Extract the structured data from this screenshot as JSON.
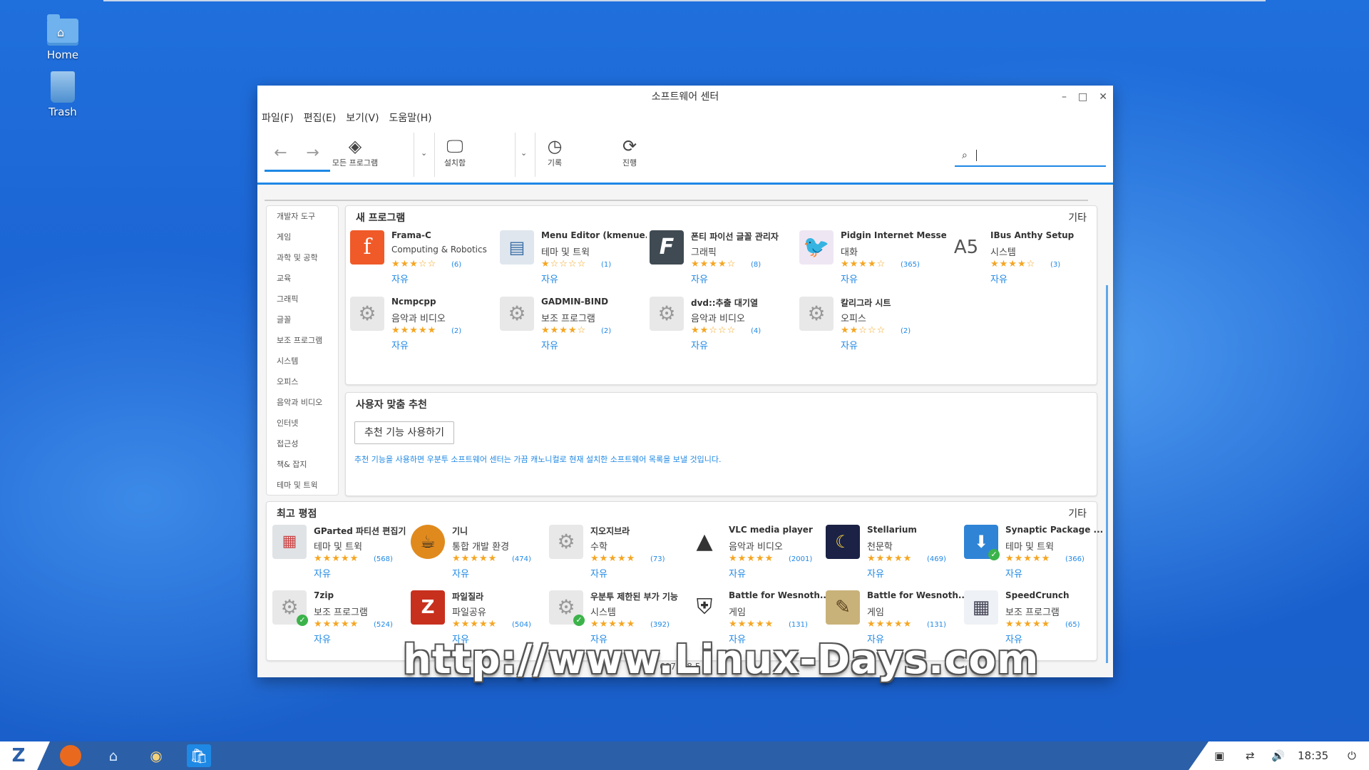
{
  "desktop": {
    "icons": [
      {
        "label": "Home"
      },
      {
        "label": "Trash"
      }
    ]
  },
  "window": {
    "title": "소프트웨어 센터",
    "menu": [
      "파일(F)",
      "편집(E)",
      "보기(V)",
      "도움말(H)"
    ],
    "toolbar": {
      "all_programs": "모든 프로그램",
      "installed": "설치함",
      "history": "기록",
      "progress": "진행"
    },
    "search": {
      "placeholder": ""
    }
  },
  "sidebar": {
    "items": [
      "개발자 도구",
      "게임",
      "과학 및 공학",
      "교육",
      "그래픽",
      "글꼴",
      "보조 프로그램",
      "시스템",
      "오피스",
      "음악과 비디오",
      "인터넷",
      "접근성",
      "책& 잡지",
      "테마 및 트윅"
    ]
  },
  "new_programs": {
    "title": "새 프로그램",
    "more": "기타",
    "apps": [
      {
        "name": "Frama-C",
        "category": "Computing & Robotics",
        "stars": "★★★☆☆",
        "count": "(6)",
        "license": "자유",
        "icon": "frama-c-icon"
      },
      {
        "name": "Menu Editor (kmenue...",
        "category": "테마 및 트윅",
        "stars": "★☆☆☆☆",
        "count": "(1)",
        "license": "자유",
        "icon": "menu-editor-icon"
      },
      {
        "name": "폰티 파이선 글꼴 관리자",
        "category": "그래픽",
        "stars": "★★★★☆",
        "count": "(8)",
        "license": "자유",
        "icon": "font-manager-icon"
      },
      {
        "name": "Pidgin Internet Messe...",
        "category": "대화",
        "stars": "★★★★☆",
        "count": "(365)",
        "license": "자유",
        "icon": "pidgin-icon"
      },
      {
        "name": "IBus Anthy Setup",
        "category": "시스템",
        "stars": "★★★★☆",
        "count": "(3)",
        "license": "자유",
        "icon": "anthy-icon"
      },
      {
        "name": "Ncmpcpp",
        "category": "음악과 비디오",
        "stars": "★★★★★",
        "count": "(2)",
        "license": "자유",
        "icon": "gear-icon"
      },
      {
        "name": "GADMIN-BIND",
        "category": "보조 프로그램",
        "stars": "★★★★☆",
        "count": "(2)",
        "license": "자유",
        "icon": "gear-icon"
      },
      {
        "name": "dvd::추출 대기열",
        "category": "음악과 비디오",
        "stars": "★★☆☆☆",
        "count": "(4)",
        "license": "자유",
        "icon": "gear-icon"
      },
      {
        "name": "칼리그라 시트",
        "category": "오피스",
        "stars": "★★☆☆☆",
        "count": "(2)",
        "license": "자유",
        "icon": "gear-icon"
      }
    ]
  },
  "recommend": {
    "title": "사용자 맞춤 추천",
    "button": "추천 기능 사용하기",
    "text": "추천 기능을 사용하면 우분투 소프트웨어 센터는 가끔 캐노니컬로 현재 설치한 소프트웨어 목록을 보낼 것입니다."
  },
  "top_rated": {
    "title": "최고 평점",
    "more": "기타",
    "apps": [
      {
        "name": "GParted 파티션 편집기",
        "category": "테마 및 트윅",
        "stars": "★★★★★",
        "count": "(568)",
        "license": "자유",
        "icon": "gparted-icon"
      },
      {
        "name": "기니",
        "category": "통합 개발 환경",
        "stars": "★★★★★",
        "count": "(474)",
        "license": "자유",
        "icon": "geany-icon"
      },
      {
        "name": "지오지브라",
        "category": "수학",
        "stars": "★★★★★",
        "count": "(73)",
        "license": "자유",
        "icon": "gear-icon"
      },
      {
        "name": "VLC media player",
        "category": "음악과 비디오",
        "stars": "★★★★★",
        "count": "(2001)",
        "license": "자유",
        "icon": "vlc-icon"
      },
      {
        "name": "Stellarium",
        "category": "천문학",
        "stars": "★★★★★",
        "count": "(469)",
        "license": "자유",
        "icon": "stellarium-icon"
      },
      {
        "name": "Synaptic Package ...",
        "category": "테마 및 트윅",
        "stars": "★★★★★",
        "count": "(366)",
        "license": "자유",
        "icon": "synaptic-icon"
      },
      {
        "name": "7zip",
        "category": "보조 프로그램",
        "stars": "★★★★★",
        "count": "(524)",
        "license": "자유",
        "icon": "gear-icon"
      },
      {
        "name": "파일질라",
        "category": "파일공유",
        "stars": "★★★★★",
        "count": "(504)",
        "license": "자유",
        "icon": "filezilla-icon"
      },
      {
        "name": "우분투 제한된 부가 기능",
        "category": "시스템",
        "stars": "★★★★★",
        "count": "(392)",
        "license": "자유",
        "icon": "gear-icon"
      },
      {
        "name": "Battle for Wesnoth...",
        "category": "게임",
        "stars": "★★★★★",
        "count": "(131)",
        "license": "자유",
        "icon": "wesnoth-icon"
      },
      {
        "name": "Battle for Wesnoth...",
        "category": "게임",
        "stars": "★★★★★",
        "count": "(131)",
        "license": "자유",
        "icon": "wesnoth-map-icon"
      },
      {
        "name": "SpeedCrunch",
        "category": "보조 프로그램",
        "stars": "★★★★★",
        "count": "(65)",
        "license": "자유",
        "icon": "speedcrunch-icon"
      }
    ]
  },
  "status": "52 697 9 8 5",
  "watermark": "http://www.Linux-Days.com",
  "taskbar": {
    "clock": "18:35"
  }
}
